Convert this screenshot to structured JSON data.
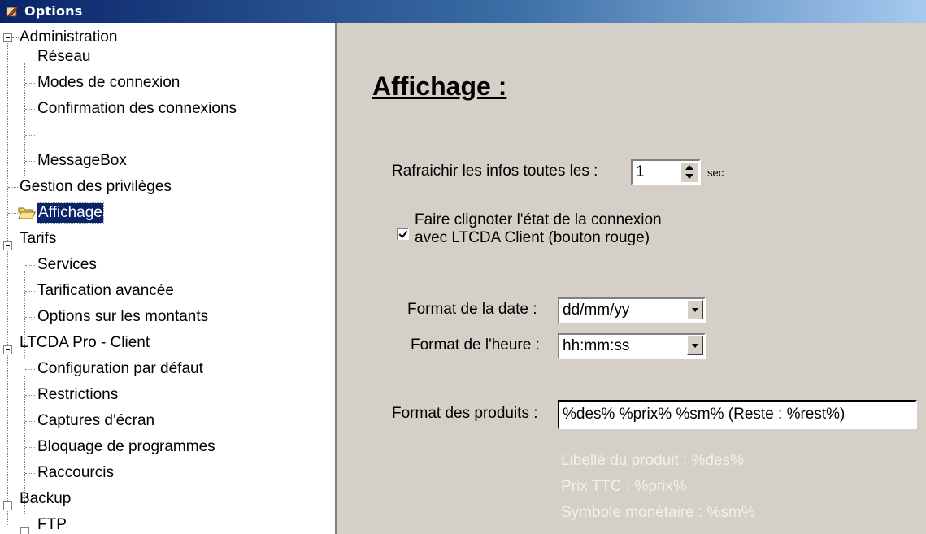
{
  "window": {
    "title": "Options"
  },
  "tree": {
    "administration": "Administration",
    "reseau": "Réseau",
    "modes": "Modes de connexion",
    "confirmation": "Confirmation des connexions",
    "messagebox": "MessageBox",
    "privileges": "Gestion des privilèges",
    "affichage": "Affichage",
    "tarifs": "Tarifs",
    "services": "Services",
    "tarification": "Tarification avancée",
    "options_montants": "Options sur les montants",
    "ltcda_client": "LTCDA Pro - Client",
    "config_defaut": "Configuration par défaut",
    "restrictions": "Restrictions",
    "captures": "Captures d'écran",
    "bloquage": "Bloquage de programmes",
    "raccourcis": "Raccourcis",
    "backup": "Backup",
    "ftp": "FTP"
  },
  "panel": {
    "heading": "Affichage :",
    "refresh_label": "Rafraichir les infos toutes les :",
    "refresh_value": "1",
    "refresh_unit": "sec",
    "blink_line1": "Faire clignoter l'état de la connexion",
    "blink_line2": "avec LTCDA Client  (bouton rouge)",
    "blink_checked": true,
    "date_label": "Format de la date :",
    "date_value": "dd/mm/yy",
    "time_label": "Format de l'heure :",
    "time_value": "hh:mm:ss",
    "products_label": "Format des produits :",
    "products_value": "%des%     %prix% %sm%     (Reste : %rest%)",
    "hint1": "Libellé du produit : %des%",
    "hint2": "Prix TTC : %prix%",
    "hint3": "Symbole monétaire : %sm%"
  }
}
